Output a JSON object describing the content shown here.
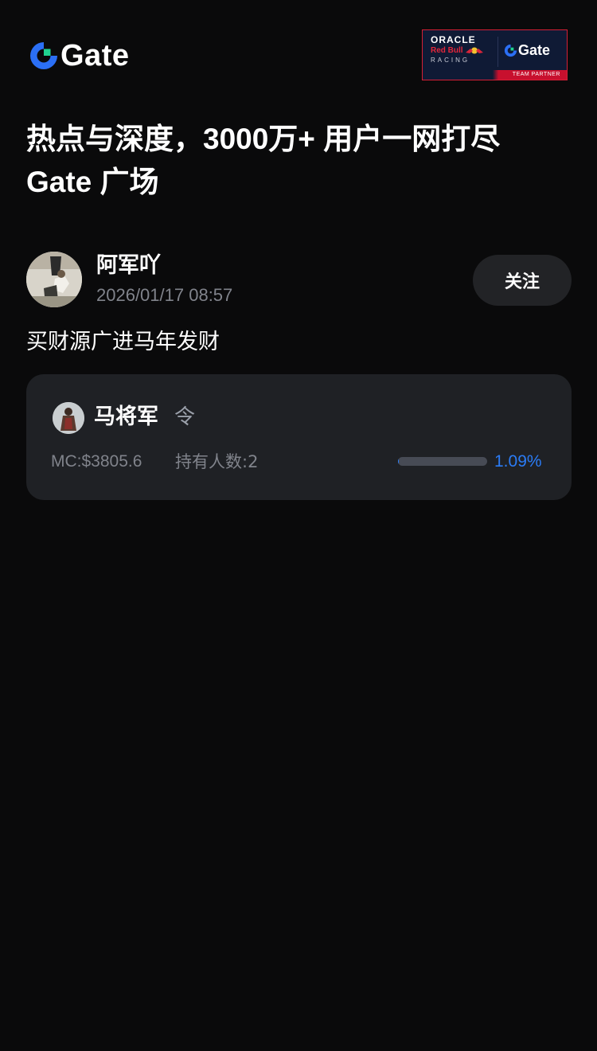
{
  "header": {
    "brand_name": "Gate",
    "partner": {
      "oracle": "ORACLE",
      "redbull": "Red Bull",
      "racing": "RACING",
      "gate": "Gate",
      "team_partner": "TEAM PARTNER"
    }
  },
  "headline": {
    "line1": "热点与深度，3000万+ 用户一网打尽",
    "line2": "Gate 广场"
  },
  "post": {
    "author_name": "阿军吖",
    "timestamp": "2026/01/17 08:57",
    "follow_label": "关注",
    "text": "买财源广进马年发财"
  },
  "token": {
    "name": "马将军",
    "symbol": "令",
    "market_cap": "MC:$3805.6",
    "holders": "持有人数:2",
    "progress_label": "1.09%",
    "progress_percent": 1.09
  },
  "colors": {
    "background": "#0a0a0b",
    "card": "#1f2125",
    "accent_blue": "#2b7cf6",
    "muted_text": "#80838b",
    "brand_red": "#d51f36"
  }
}
